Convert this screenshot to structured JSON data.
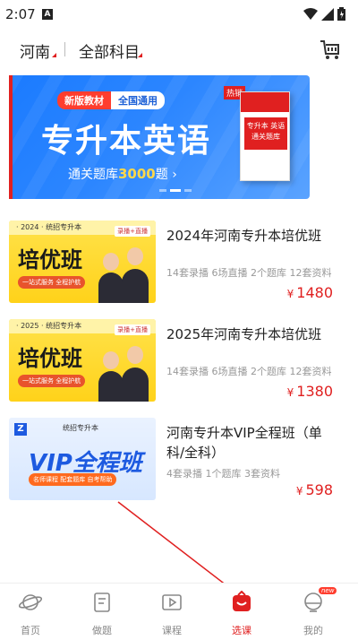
{
  "status_bar": {
    "time": "2:07",
    "notification_glyph": "A"
  },
  "filters": {
    "region": "河南",
    "subject": "全部科目"
  },
  "icons": {
    "cart": "cart-icon"
  },
  "banner": {
    "tag_new": "新版教材",
    "tag_general": "全国通用",
    "title": "专升本英语",
    "subtitle_prefix": "通关题库",
    "subtitle_number": "3000",
    "subtitle_suffix": "题 ›",
    "book_badge": "热销",
    "book_text": "专升本 英语 通关题库"
  },
  "courses": [
    {
      "thumb_top": "· 2024 · 统招专升本",
      "thumb_title": "培优班",
      "thumb_tag": "录播+直播",
      "thumb_pill": "一站式服务 全程护航",
      "title": "2024年河南专升本培优班",
      "meta": "14套录播 6场直播 2个题库 12套资料",
      "price": "1480",
      "currency": "¥"
    },
    {
      "thumb_top": "· 2025 · 统招专升本",
      "thumb_title": "培优班",
      "thumb_tag": "录播+直播",
      "thumb_pill": "一站式服务 全程护航",
      "title": "2025年河南专升本培优班",
      "meta": "14套录播 6场直播 2个题库 12套资料",
      "price": "1380",
      "currency": "¥"
    },
    {
      "thumb_top": "统招专升本",
      "thumb_title": "VIP全程班",
      "thumb_pill": "名师课程 配套题库 自考帮助",
      "title": "河南专升本VIP全程班（单科/全科）",
      "meta": "4套录播 1个题库 3套资料",
      "price": "598",
      "currency": "¥"
    }
  ],
  "nav": [
    {
      "label": "首页",
      "icon": "home-planet-icon"
    },
    {
      "label": "做题",
      "icon": "notebook-icon"
    },
    {
      "label": "课程",
      "icon": "play-course-icon"
    },
    {
      "label": "选课",
      "icon": "select-course-icon",
      "active": true
    },
    {
      "label": "我的",
      "icon": "profile-icon",
      "badge": "new"
    }
  ],
  "colors": {
    "accent": "#e02020",
    "banner_blue": "#1b7bff",
    "thumb_yellow": "#ffd21a"
  }
}
